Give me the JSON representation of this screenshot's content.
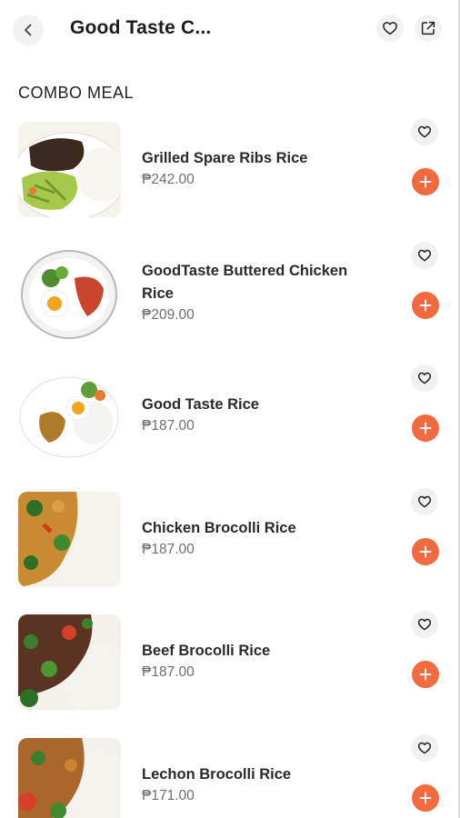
{
  "header": {
    "title": "Good Taste C...",
    "back_icon": "chevron-left-icon",
    "favorite_icon": "heart-icon",
    "share_icon": "share-icon"
  },
  "section": {
    "title": "COMBO MEAL"
  },
  "items": [
    {
      "name": "Grilled Spare Ribs Rice",
      "price": "₱242.00"
    },
    {
      "name": "GoodTaste Buttered Chicken Rice",
      "price": "₱209.00"
    },
    {
      "name": "Good Taste Rice",
      "price": "₱187.00"
    },
    {
      "name": "Chicken Brocolli Rice",
      "price": "₱187.00"
    },
    {
      "name": "Beef Brocolli Rice",
      "price": "₱187.00"
    },
    {
      "name": "Lechon Brocolli Rice",
      "price": "₱171.00"
    }
  ],
  "colors": {
    "accent": "#f26a3d",
    "icon_bg": "#f2f2f2"
  }
}
